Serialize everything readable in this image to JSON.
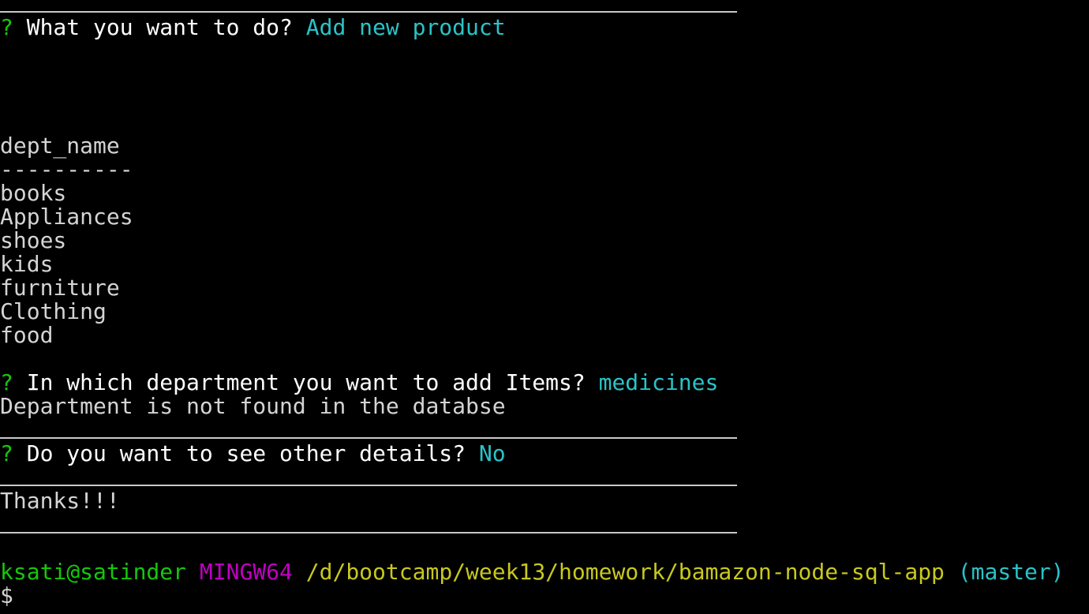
{
  "colors": {
    "background": "#000000",
    "text": "#d4d4d4",
    "question_mark": "#16c60c",
    "answer": "#2ac3c8",
    "user": "#16c60c",
    "shell": "#c000c0",
    "path": "#c8c820",
    "branch": "#2ac3c8"
  },
  "q1": {
    "mark": "?",
    "question": "What you want to do?",
    "answer": "Add new product"
  },
  "table": {
    "header": "dept_name",
    "separator": "----------",
    "rows": [
      "books",
      "Appliances",
      "shoes",
      "kids",
      "furniture",
      "Clothing",
      "food"
    ]
  },
  "q2": {
    "mark": "?",
    "question": "In which department you want to add Items?",
    "answer": "medicines"
  },
  "error_message": "Department is not found in the databse",
  "q3": {
    "mark": "?",
    "question": "Do you want to see other details?",
    "answer": "No"
  },
  "thanks": "Thanks!!!",
  "shell_prompt": {
    "user_host": "ksati@satinder",
    "shell": "MINGW64",
    "path": "/d/bootcamp/week13/homework/bamazon-node-sql-app",
    "branch": "(master)",
    "symbol": "$"
  }
}
